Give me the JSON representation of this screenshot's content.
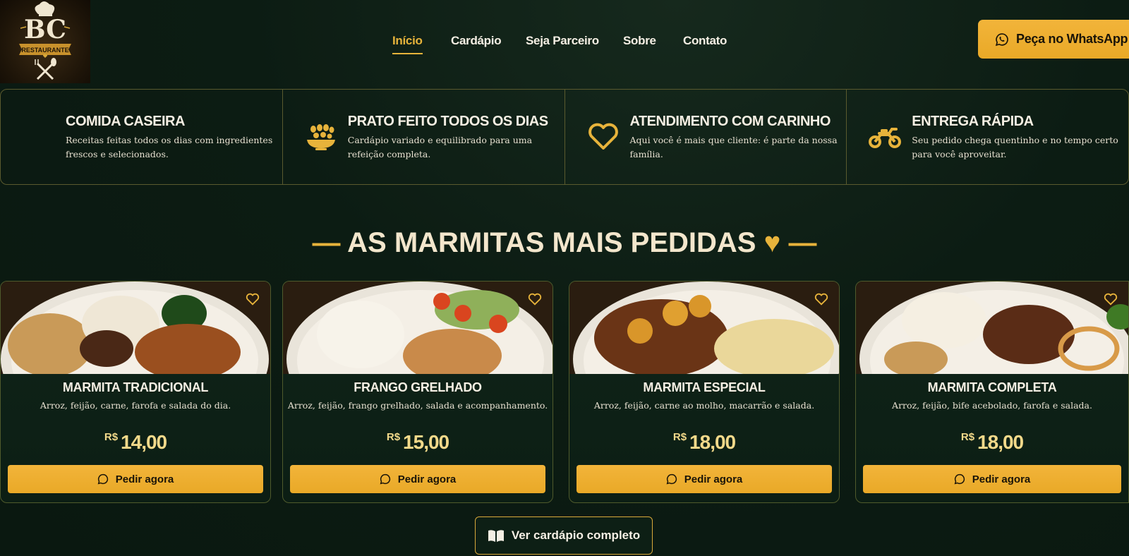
{
  "logo": {
    "letters": "BC",
    "ribbon": "RESTAURANTE"
  },
  "nav": {
    "items": [
      {
        "label": "Início",
        "active": true
      },
      {
        "label": "Cardápio",
        "active": false
      },
      {
        "label": "Seja Parceiro",
        "active": false
      },
      {
        "label": "Sobre",
        "active": false
      },
      {
        "label": "Contato",
        "active": false
      }
    ]
  },
  "cta": {
    "whatsapp_label": "Peça no WhatsApp",
    "icon": "whatsapp-icon"
  },
  "features": [
    {
      "icon": "none",
      "title": "COMIDA CASEIRA",
      "text": "Receitas feitas todos os dias com ingredientes frescos e selecionados."
    },
    {
      "icon": "bowl-icon",
      "title": "PRATO FEITO TODOS OS DIAS",
      "text": "Cardápio variado e equilibrado para uma refeição completa."
    },
    {
      "icon": "heart-icon",
      "title": "ATENDIMENTO COM CARINHO",
      "text": "Aqui você é mais que cliente: é parte da nossa família."
    },
    {
      "icon": "motorcycle-icon",
      "title": "ENTREGA RÁPIDA",
      "text": "Seu pedido chega quentinho e no tempo certo para você aproveitar."
    }
  ],
  "section": {
    "dash_left": "—",
    "title": "AS MARMITAS MAIS PEDIDAS",
    "heart": "♥",
    "dash_right": "—"
  },
  "products": [
    {
      "name": "MARMITA TRADICIONAL",
      "desc": "Arroz, feijão, carne, farofa e salada do dia.",
      "currency": "R$",
      "price": "14,00",
      "button": "Pedir agora"
    },
    {
      "name": "FRANGO GRELHADO",
      "desc": "Arroz, feijão, frango grelhado, salada e acompanhamento.",
      "currency": "R$",
      "price": "15,00",
      "button": "Pedir agora"
    },
    {
      "name": "MARMITA ESPECIAL",
      "desc": "Arroz, feijão, carne ao molho, macarrão e salada.",
      "currency": "R$",
      "price": "18,00",
      "button": "Pedir agora"
    },
    {
      "name": "MARMITA COMPLETA",
      "desc": "Arroz, feijão, bife acebolado, farofa e salada.",
      "currency": "R$",
      "price": "18,00",
      "button": "Pedir agora"
    }
  ],
  "menu_button": {
    "label": "Ver cardápio completo",
    "icon": "book-icon"
  },
  "colors": {
    "accent": "#e7b33b",
    "background": "#0c1c13",
    "text": "#f3ead8"
  }
}
